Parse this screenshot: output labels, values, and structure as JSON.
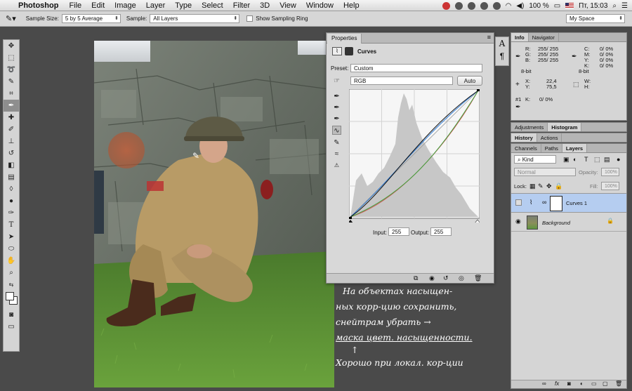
{
  "menubar": {
    "app": "Photoshop",
    "items": [
      "File",
      "Edit",
      "Image",
      "Layer",
      "Type",
      "Select",
      "Filter",
      "3D",
      "View",
      "Window",
      "Help"
    ],
    "battery": "100 %",
    "clock": "Пт, 15:03"
  },
  "options": {
    "sample_size_label": "Sample Size:",
    "sample_size_value": "5 by 5 Average",
    "sample_label": "Sample:",
    "sample_value": "All Layers",
    "ring_label": "Show Sampling Ring",
    "workspace": "My Space"
  },
  "properties": {
    "tab": "Properties",
    "title": "Curves",
    "preset_label": "Preset:",
    "preset_value": "Custom",
    "channel_value": "RGB",
    "auto_label": "Auto",
    "input_label": "Input:",
    "input_value": "255",
    "output_label": "Output:",
    "output_value": "255"
  },
  "info": {
    "tabs": [
      "Info",
      "Navigator"
    ],
    "r": "R:",
    "g": "G:",
    "b": "B:",
    "r_val": "255/ 255",
    "g_val": "255/ 255",
    "b_val": "255/ 255",
    "c": "C:",
    "m": "M:",
    "y": "Y:",
    "k": "K:",
    "c_val": "0/ 0%",
    "m_val": "0/ 0%",
    "y_val": "0/ 0%",
    "k_val": "0/ 0%",
    "bit_left": "8-bit",
    "bit_right": "8-bit",
    "x": "X:",
    "y_coord": "Y:",
    "x_val": "22,4",
    "y_val_coord": "75,5",
    "w": "W:",
    "h": "H:",
    "s1": "#1",
    "s1k": "K:",
    "s1_val": "0/ 0%"
  },
  "adj": {
    "tabs": [
      "Adjustments",
      "Histogram"
    ]
  },
  "hist": {
    "tabs": [
      "History",
      "Actions"
    ]
  },
  "layers": {
    "tabs": [
      "Channels",
      "Paths",
      "Layers"
    ],
    "kind": "Kind",
    "blend": "Normal",
    "opacity_label": "Opacity:",
    "opacity": "100%",
    "lock_label": "Lock:",
    "fill_label": "Fill:",
    "fill": "100%",
    "items": [
      {
        "name": "Curves 1"
      },
      {
        "name": "Background"
      }
    ]
  },
  "note": {
    "lines": [
      "На объектах насыщен-",
      "ных корр-цию сохранить,",
      "снейтрам убрать →",
      "маска цвет. насыщенности.",
      "↑",
      "Хорошо при локал. кор-ции"
    ]
  },
  "colors": {
    "accent_selected": "#b5cdf0",
    "photo_grass": "#4e8a2e",
    "photo_uniform": "#b89b66"
  }
}
